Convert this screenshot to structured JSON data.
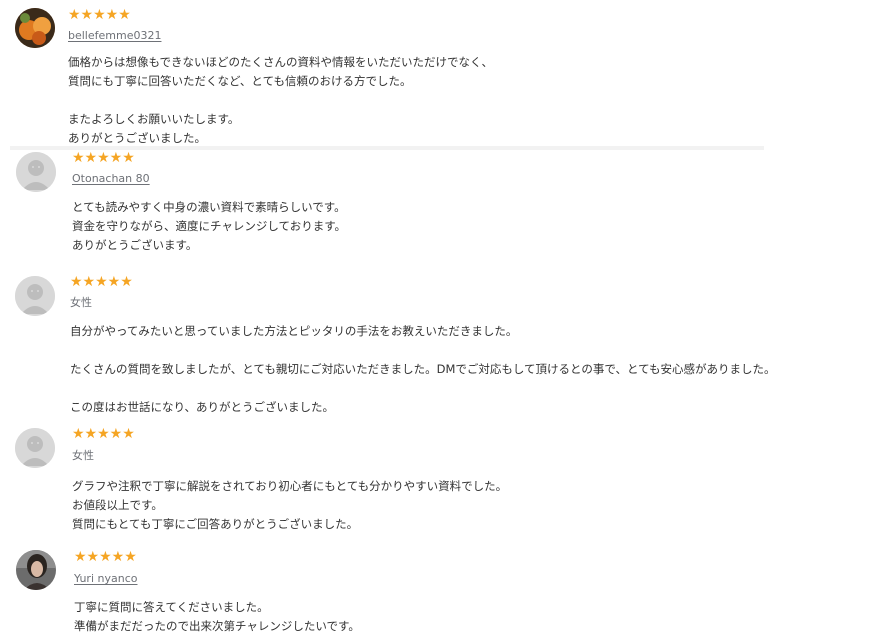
{
  "colors": {
    "star": "#f5a524",
    "text": "#333333",
    "username": "#6e7177",
    "avatar_default": "#d8d8d8"
  },
  "reviews": [
    {
      "rating": "★★★★★",
      "author": "bellefemme0321",
      "lines": [
        "価格からは想像もできないほどのたくさんの資料や情報をいただいただけでなく、",
        "質問にも丁寧に回答いただくなど、とても信頼のおける方でした。",
        "",
        "またよろしくお願いいたします。",
        "ありがとうございました。"
      ]
    },
    {
      "rating": "★★★★★",
      "author": "Otonachan 80",
      "lines": [
        "とても読みやすく中身の濃い資料で素晴らしいです。",
        "資金を守りながら、適度にチャレンジしております。",
        "ありがとうございます。"
      ]
    },
    {
      "rating": "★★★★★",
      "author": "女性",
      "lines": [
        "自分がやってみたいと思っていました方法とピッタリの手法をお教えいただきました。",
        "",
        "たくさんの質問を致しましたが、とても親切にご対応いただきました。DMでご対応もして頂けるとの事で、とても安心感がありました。",
        "",
        "この度はお世話になり、ありがとうございました。"
      ]
    },
    {
      "rating": "★★★★★",
      "author": "女性",
      "lines": [
        "グラフや注釈で丁寧に解説をされており初心者にもとても分かりやすい資料でした。",
        "お値段以上です。",
        "質問にもとても丁寧にご回答ありがとうございました。"
      ]
    },
    {
      "rating": "★★★★★",
      "author": "Yuri nyanco",
      "lines": [
        "丁寧に質問に答えてくださいました。",
        "準備がまだだったので出来次第チャレンジしたいです。"
      ]
    }
  ]
}
